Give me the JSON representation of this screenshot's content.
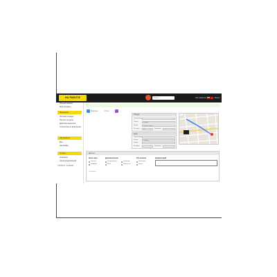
{
  "header": {
    "logo": "НА РАБОТЕ",
    "search_placeholder": "Поиск",
    "user": "Имя Фамилия",
    "logout": "Выйти"
  },
  "sidebar": {
    "top_links": [
      "Личный кабинет",
      "Мой профиль"
    ],
    "sections": [
      {
        "title": "Маршруты",
        "links": [
          "История поездок",
          "Прогноз на день",
          "Действия водителя",
          "Статистика по водителям"
        ]
      },
      {
        "title": "Автомобили",
        "links": [
          "Все",
          "Настройки"
        ]
      },
      {
        "title": "Отчеты",
        "links": [
          "Компания",
          "Архив уведомлений"
        ]
      }
    ],
    "status": "Online Users"
  },
  "tabs": [
    {
      "label": "Водитель",
      "color": "#3f8fd4"
    },
    {
      "label": "Отчет",
      "color": "#8c5cb8"
    }
  ],
  "panels": [
    {
      "title": "Откуда",
      "fields": [
        {
          "label": "Организация",
          "value": ""
        },
        {
          "label": "Улица",
          "value": "Укажите"
        },
        {
          "label": "Город",
          "value": "Укажите город"
        },
        {
          "label": "№ дома",
          "value": "20"
        }
      ],
      "extra": "Квартира"
    },
    {
      "title": "Куда",
      "fields": [
        {
          "label": "Организация",
          "value": ""
        },
        {
          "label": "Улица",
          "value": "Укажите"
        },
        {
          "label": "Город",
          "value": ""
        },
        {
          "label": "№ дома",
          "value": ""
        }
      ],
      "extra": "Квартира"
    }
  ],
  "bottom": {
    "title": "Детали",
    "columns": [
      {
        "head": "Класс авто",
        "options": [
          {
            "label": "Эконом",
            "checked": false
          },
          {
            "label": "Комфорт",
            "checked": true
          }
        ]
      },
      {
        "head": "Дополнительно",
        "options": [
          {
            "label": "Кондиционер",
            "checked": false
          },
          {
            "label": "Wi-Fi",
            "checked": false
          }
        ]
      },
      {
        "head": "",
        "options": [
          {
            "label": "Багажник",
            "checked": false
          },
          {
            "label": "Животные",
            "checked": false
          }
        ]
      },
      {
        "head": "Тип оплаты",
        "options": [
          {
            "label": "Наличные",
            "checked": false
          },
          {
            "label": "Карта",
            "checked": false
          }
        ]
      }
    ],
    "comment_label": "Комментарий",
    "save_label": "Сохранить"
  },
  "colors": {
    "accent": "#f5d90a",
    "topbar": "#1b1b1b",
    "record": "#e8522a",
    "link": "#3f8fd4"
  }
}
